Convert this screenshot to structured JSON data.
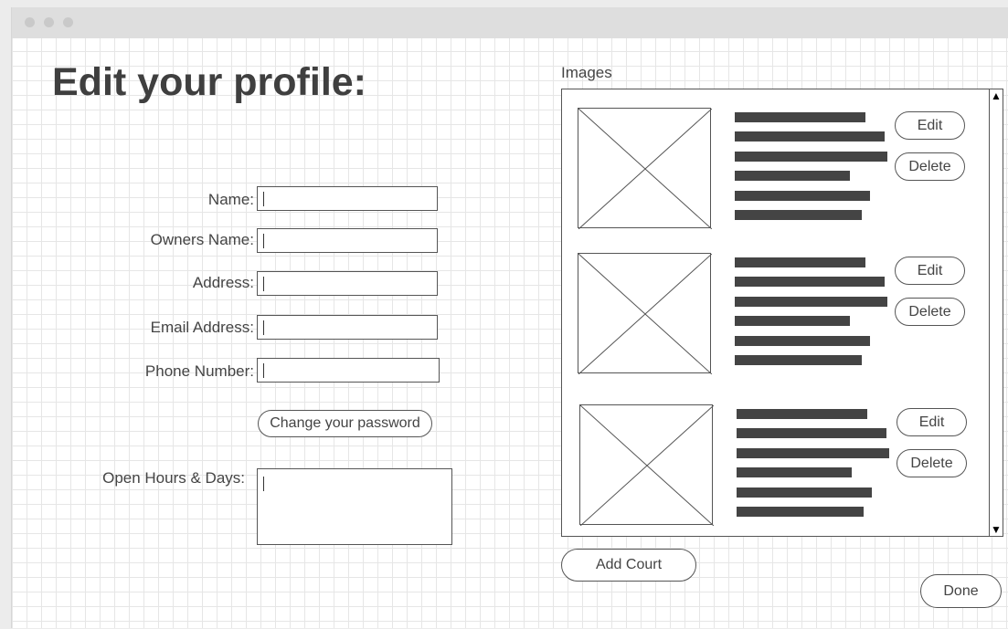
{
  "page": {
    "title": "Edit your profile:"
  },
  "form": {
    "fields": [
      {
        "label": "Name:",
        "value": ""
      },
      {
        "label": "Owners Name:",
        "value": ""
      },
      {
        "label": "Address:",
        "value": ""
      },
      {
        "label": "Email Address:",
        "value": ""
      },
      {
        "label": "Phone Number:",
        "value": ""
      }
    ],
    "change_password_label": "Change your password",
    "hours_label": "Open Hours & Days:",
    "hours_value": ""
  },
  "images": {
    "label": "Images",
    "items": [
      {
        "edit_label": "Edit",
        "delete_label": "Delete"
      },
      {
        "edit_label": "Edit",
        "delete_label": "Delete"
      },
      {
        "edit_label": "Edit",
        "delete_label": "Delete"
      }
    ],
    "scroll_up_icon": "triangle-up",
    "scroll_down_icon": "triangle-down",
    "image_placeholder_icon": "crossed-box"
  },
  "actions": {
    "add_court_label": "Add Court",
    "done_label": "Done"
  },
  "colors": {
    "text": "#444444",
    "text_bar": "#444444",
    "grid_line": "#e6e6e6",
    "titlebar": "#dedede"
  }
}
